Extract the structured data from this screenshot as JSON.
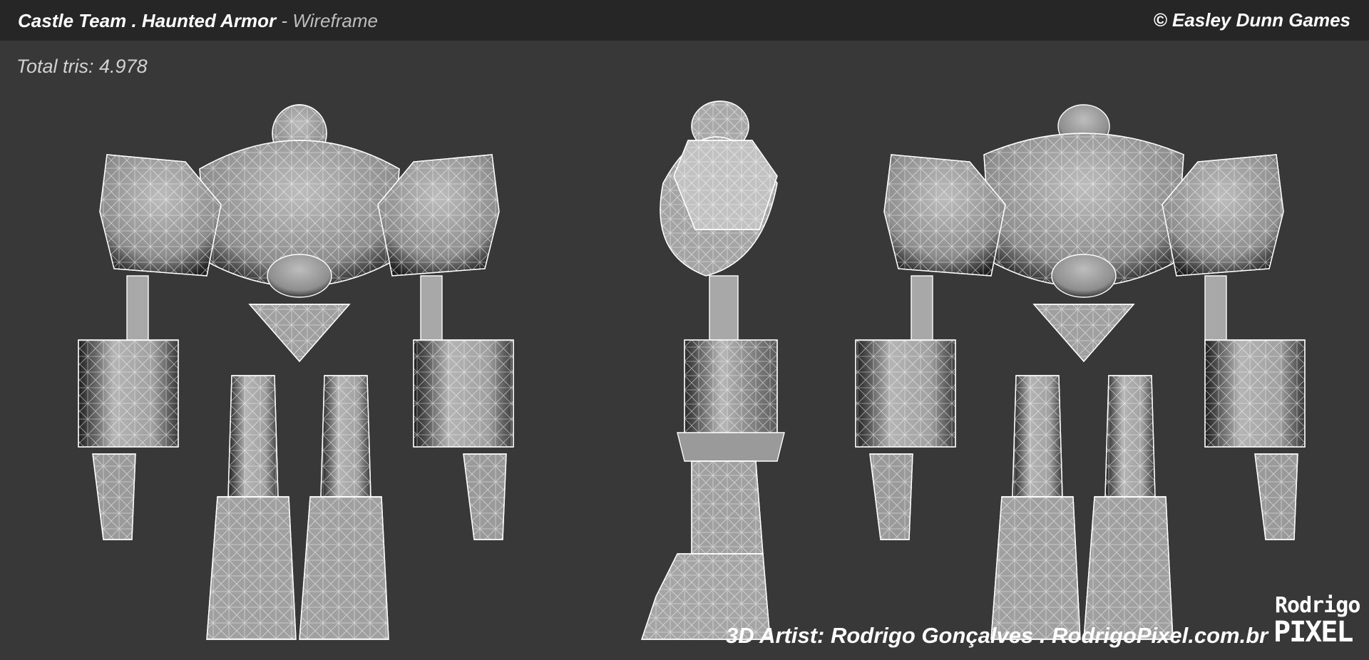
{
  "header": {
    "title_main": "Castle Team . Haunted Armor",
    "title_sep": " - ",
    "title_mode": "Wireframe",
    "copyright": "© Easley Dunn Games"
  },
  "stats": {
    "total_tris": "Total tris: 4.978"
  },
  "footer": {
    "credit": "3D Artist: Rodrigo Gonçalves . RodrigoPixel.com.br",
    "logo_line1": "Rodrigo",
    "logo_line2": "PIXEL"
  },
  "views": [
    "front-view",
    "side-view",
    "back-view"
  ],
  "colors": {
    "background": "#383838",
    "topbar": "#262626",
    "mesh_fill": "#a9a9a9",
    "wire": "#ffffff"
  }
}
